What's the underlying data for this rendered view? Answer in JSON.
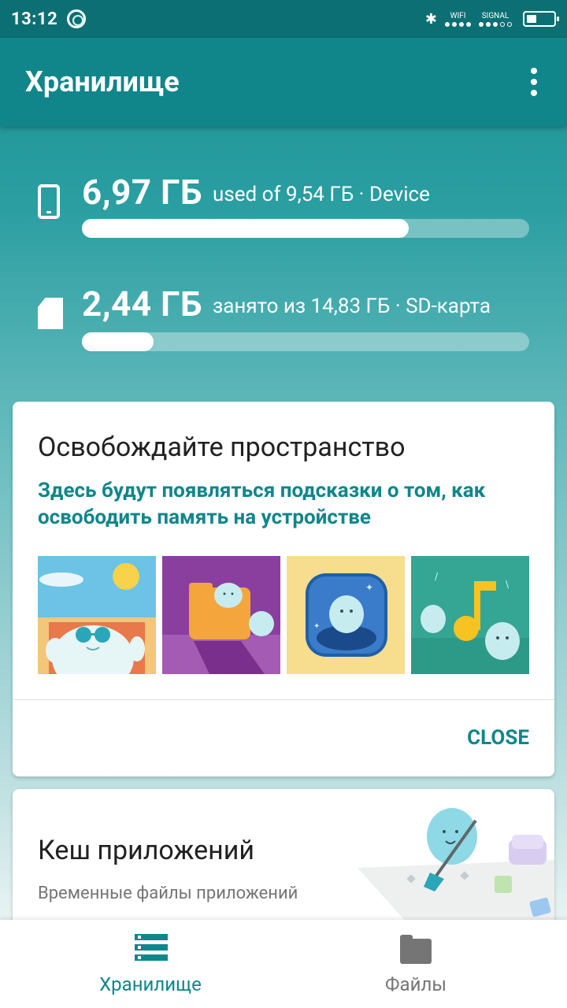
{
  "status_bar": {
    "time": "13:12",
    "wifi_label": "WIFI",
    "signal_label": "SIGNAL"
  },
  "app_bar": {
    "title": "Хранилище"
  },
  "storage": [
    {
      "amount": "6,97 ГБ",
      "description": "used of 9,54 ГБ · Device",
      "used_fraction": 0.73
    },
    {
      "amount": "2,44 ГБ",
      "description": "занято из 14,83 ГБ · SD-карта",
      "used_fraction": 0.16
    }
  ],
  "tips_card": {
    "heading": "Освобождайте пространство",
    "subtitle": "Здесь будут появляться подсказки о том, как освободить память на устройстве",
    "close_label": "CLOSE"
  },
  "cache_card": {
    "heading": "Кеш приложений",
    "subtitle": "Временные файлы приложений"
  },
  "bottom_nav": [
    {
      "label": "Хранилище",
      "icon": "storage-list-icon",
      "active": true
    },
    {
      "label": "Файлы",
      "icon": "folder-icon",
      "active": false
    }
  ],
  "colors": {
    "primary": "#10868a",
    "status_bar": "#0c6f73"
  }
}
